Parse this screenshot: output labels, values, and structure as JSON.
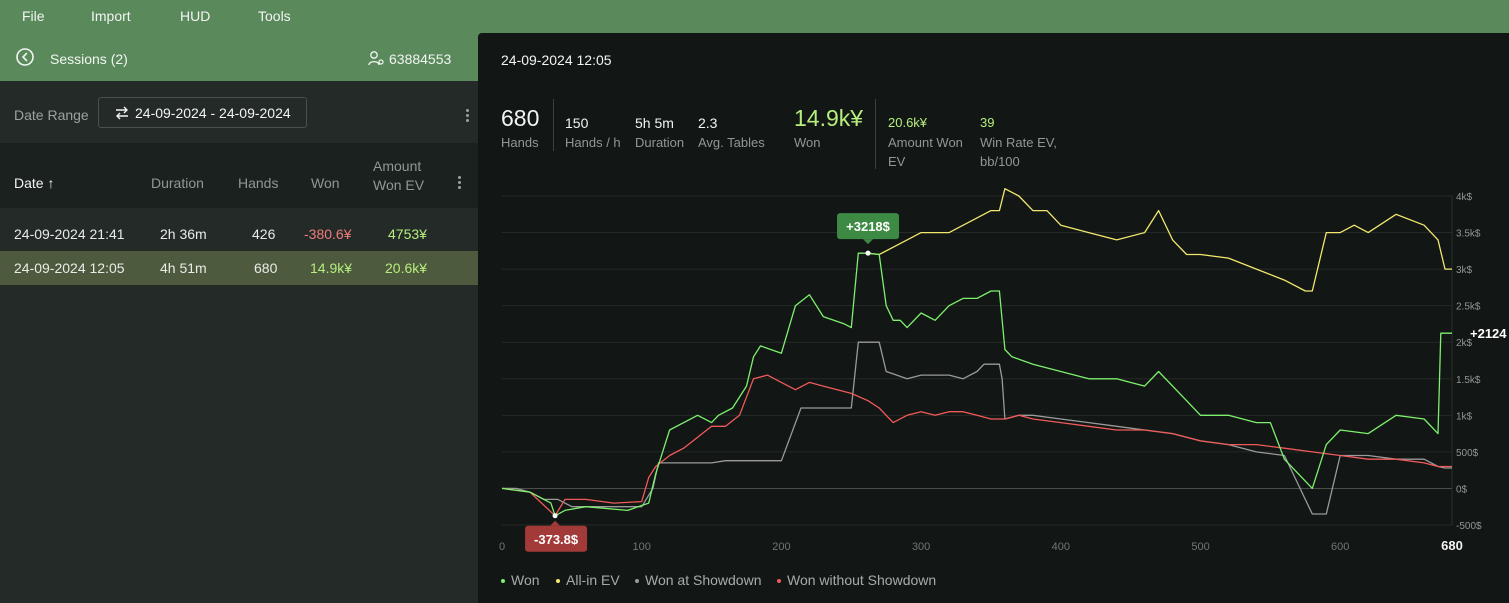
{
  "menu": {
    "items": [
      "File",
      "Import",
      "HUD",
      "Tools"
    ]
  },
  "sessions_panel": {
    "title": "Sessions (2)",
    "user_id": "63884553",
    "date_range_label": "Date Range",
    "date_range_value": "24-09-2024 - 24-09-2024",
    "columns": {
      "date": "Date ↑",
      "duration": "Duration",
      "hands": "Hands",
      "won": "Won",
      "amount_won_ev": "Amount Won EV"
    },
    "rows": [
      {
        "date": "24-09-2024 21:41",
        "duration": "2h 36m",
        "hands": "426",
        "won": "-380.6¥",
        "ev": "4753¥"
      },
      {
        "date": "24-09-2024 12:05",
        "duration": "4h 51m",
        "hands": "680",
        "won": "14.9k¥",
        "ev": "20.6k¥"
      }
    ]
  },
  "session_detail": {
    "date": "24-09-2024 12:05",
    "stats": {
      "hands": {
        "value": "680",
        "label": "Hands"
      },
      "hands_per_hour": {
        "value": "150",
        "label": "Hands / h"
      },
      "duration": {
        "value": "5h 5m",
        "label": "Duration"
      },
      "avg_tables": {
        "value": "2.3",
        "label": "Avg. Tables"
      },
      "won": {
        "value": "14.9k¥",
        "label": "Won"
      },
      "amount_won_ev": {
        "value": "20.6k¥",
        "label_1": "Amount Won",
        "label_2": "EV"
      },
      "win_rate_ev": {
        "value": "39",
        "label_1": "Win Rate EV,",
        "label_2": "bb/100"
      }
    }
  },
  "colors": {
    "won": "#7df06e",
    "all_in_ev": "#f2e86e",
    "showdown": "#9a9a9a",
    "no_showdown": "#f05a5a",
    "accent_green": "#5a8a5c"
  },
  "chart_data": {
    "type": "line",
    "xlim": [
      0,
      680
    ],
    "ylim": [
      -500,
      4000
    ],
    "x_ticks": [
      "0",
      "100",
      "200",
      "300",
      "400",
      "500",
      "600",
      "680"
    ],
    "y_ticks": [
      "4k$",
      "3.5k$",
      "3k$",
      "2.5k$",
      "2k$",
      "1.5k$",
      "1k$",
      "500$",
      "0$",
      "-500$"
    ],
    "y_tick_values": [
      4000,
      3500,
      3000,
      2500,
      2000,
      1500,
      1000,
      500,
      0,
      -500
    ],
    "annotations": {
      "max": "+3218$",
      "min": "-373.8$",
      "end": "+2124"
    },
    "max_point": [
      262,
      3218
    ],
    "min_point": [
      38,
      -374
    ],
    "series": [
      {
        "name": "Won",
        "color": "#7df06e",
        "x": [
          0,
          20,
          35,
          38,
          45,
          60,
          90,
          105,
          110,
          120,
          140,
          150,
          155,
          165,
          175,
          180,
          185,
          200,
          210,
          220,
          230,
          245,
          250,
          255,
          262,
          270,
          275,
          280,
          285,
          290,
          300,
          310,
          320,
          330,
          340,
          350,
          356,
          360,
          365,
          380,
          400,
          420,
          440,
          460,
          470,
          490,
          500,
          520,
          540,
          550,
          560,
          580,
          590,
          600,
          620,
          640,
          660,
          670,
          672,
          680
        ],
        "y": [
          0,
          -50,
          -200,
          -374,
          -300,
          -250,
          -300,
          -200,
          200,
          800,
          1000,
          900,
          1000,
          1100,
          1400,
          1800,
          1950,
          1850,
          2500,
          2650,
          2350,
          2250,
          2200,
          3218,
          3218,
          3200,
          2500,
          2300,
          2300,
          2200,
          2400,
          2300,
          2500,
          2600,
          2600,
          2700,
          2700,
          1900,
          1800,
          1700,
          1600,
          1500,
          1500,
          1400,
          1600,
          1200,
          1000,
          1000,
          900,
          900,
          400,
          0,
          600,
          800,
          750,
          1000,
          950,
          750,
          2124,
          2124
        ]
      },
      {
        "name": "All-in EV",
        "color": "#f2e86e",
        "x": [
          262,
          270,
          280,
          290,
          300,
          310,
          320,
          340,
          350,
          356,
          360,
          370,
          380,
          390,
          400,
          420,
          440,
          460,
          470,
          480,
          490,
          500,
          520,
          540,
          560,
          575,
          580,
          590,
          600,
          610,
          620,
          640,
          660,
          670,
          675,
          680
        ],
        "y": [
          3218,
          3200,
          3300,
          3400,
          3500,
          3500,
          3500,
          3700,
          3800,
          3800,
          4100,
          4000,
          3800,
          3800,
          3600,
          3500,
          3400,
          3500,
          3800,
          3400,
          3200,
          3200,
          3150,
          3000,
          2850,
          2700,
          2700,
          3500,
          3500,
          3600,
          3500,
          3750,
          3600,
          3400,
          3000,
          3000
        ]
      },
      {
        "name": "Won at Showdown",
        "color": "#9a9a9a",
        "x": [
          0,
          10,
          20,
          30,
          40,
          50,
          80,
          100,
          108,
          112,
          130,
          150,
          160,
          180,
          200,
          214,
          220,
          240,
          250,
          255,
          262,
          270,
          275,
          290,
          300,
          320,
          330,
          340,
          345,
          356,
          358,
          360,
          370,
          380,
          400,
          420,
          440,
          460,
          480,
          490,
          500,
          520,
          540,
          560,
          575,
          580,
          590,
          600,
          620,
          640,
          660,
          670,
          675,
          680
        ],
        "y": [
          0,
          0,
          -50,
          -150,
          -150,
          -250,
          -250,
          -250,
          0,
          350,
          350,
          350,
          380,
          380,
          380,
          1100,
          1100,
          1100,
          1100,
          2000,
          2000,
          2000,
          1600,
          1500,
          1550,
          1550,
          1500,
          1600,
          1700,
          1700,
          1500,
          950,
          1000,
          1000,
          950,
          900,
          850,
          800,
          750,
          700,
          650,
          600,
          500,
          450,
          -150,
          -350,
          -350,
          450,
          450,
          400,
          400,
          300,
          280,
          280
        ]
      },
      {
        "name": "Won without Showdown",
        "color": "#f05a5a",
        "x": [
          0,
          20,
          38,
          45,
          60,
          80,
          100,
          105,
          110,
          120,
          130,
          150,
          160,
          170,
          180,
          190,
          200,
          210,
          220,
          230,
          240,
          250,
          262,
          270,
          280,
          290,
          300,
          310,
          320,
          330,
          340,
          350,
          360,
          370,
          380,
          400,
          420,
          440,
          460,
          480,
          490,
          500,
          520,
          540,
          560,
          580,
          600,
          620,
          640,
          660,
          670,
          680
        ],
        "y": [
          0,
          -50,
          -374,
          -150,
          -150,
          -200,
          -180,
          150,
          300,
          450,
          550,
          850,
          850,
          1000,
          1500,
          1550,
          1450,
          1350,
          1450,
          1400,
          1350,
          1300,
          1200,
          1100,
          900,
          1000,
          1050,
          1000,
          1050,
          1050,
          1000,
          950,
          950,
          1000,
          950,
          900,
          850,
          800,
          800,
          750,
          700,
          650,
          600,
          600,
          550,
          500,
          450,
          400,
          400,
          350,
          300,
          300
        ]
      }
    ]
  }
}
